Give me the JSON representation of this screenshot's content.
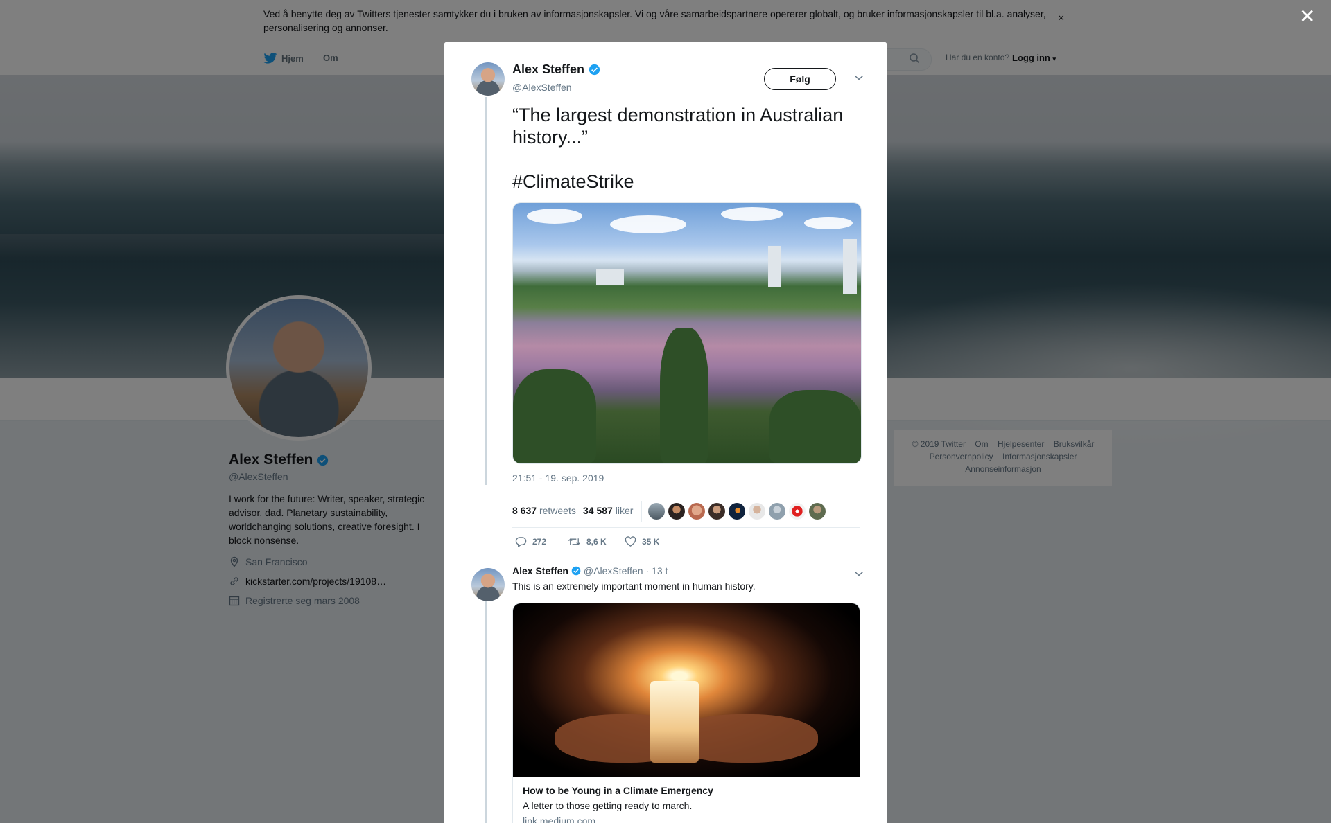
{
  "cookie": {
    "text": "Ved å benytte deg av Twitters tjenester samtykker du i bruken av informasjonskapsler. Vi og våre samarbeidspartnere opererer globalt, og bruker informasjonskapsler til bl.a. analyser, personalisering og annonser.",
    "close": "×"
  },
  "nav": {
    "home": "Hjem",
    "about": "Om",
    "account_prompt": "Har du en konto?",
    "login": "Logg inn"
  },
  "profile": {
    "name": "Alex Steffen",
    "handle": "@AlexSteffen",
    "bio": "I work for the future: Writer, speaker, strategic advisor, dad. Planetary sustainability, worldchanging solutions, creative foresight. I block nonsense.",
    "location": "San Francisco",
    "link": "kickstarter.com/projects/19108…",
    "joined": "Registrerte seg mars 2008"
  },
  "footer": {
    "items": [
      "© 2019 Twitter",
      "Om",
      "Hjelpesenter",
      "Bruksvilkår",
      "Personvernpolicy",
      "Informasjonskapsler",
      "Annonseinformasjon"
    ]
  },
  "overlay": {
    "close": "✕"
  },
  "tweet": {
    "name": "Alex Steffen",
    "handle": "@AlexSteffen",
    "follow": "Følg",
    "text": "“The largest demonstration in Australian history...”",
    "hashtag": "#ClimateStrike",
    "time": "21:51 - 19. sep. 2019",
    "retweets_count": "8 637",
    "retweets_label": "retweets",
    "likes_count": "34 587",
    "likes_label": "liker",
    "replies": "272",
    "retweets_short": "8,6 K",
    "likes_short": "35 K"
  },
  "reply": {
    "name": "Alex Steffen",
    "handle": "@AlexSteffen",
    "age": "· 13 t",
    "text": "This is an extremely important moment in human history.",
    "card_title": "How to be Young in a Climate Emergency",
    "card_desc": "A letter to those getting ready to march.",
    "card_url": "link.medium.com"
  },
  "colors": {
    "verified": "#1da1f2",
    "link_blue": "#1da1f2",
    "text_primary": "#14171a",
    "text_secondary": "#657786",
    "overlay": "rgba(0,0,0,0.5)"
  },
  "icons": [
    "twitter-bird-icon",
    "search-icon",
    "verified-icon",
    "location-icon",
    "link-icon",
    "calendar-icon",
    "reply-icon",
    "retweet-icon",
    "heart-icon",
    "chevron-down-icon",
    "close-icon"
  ]
}
